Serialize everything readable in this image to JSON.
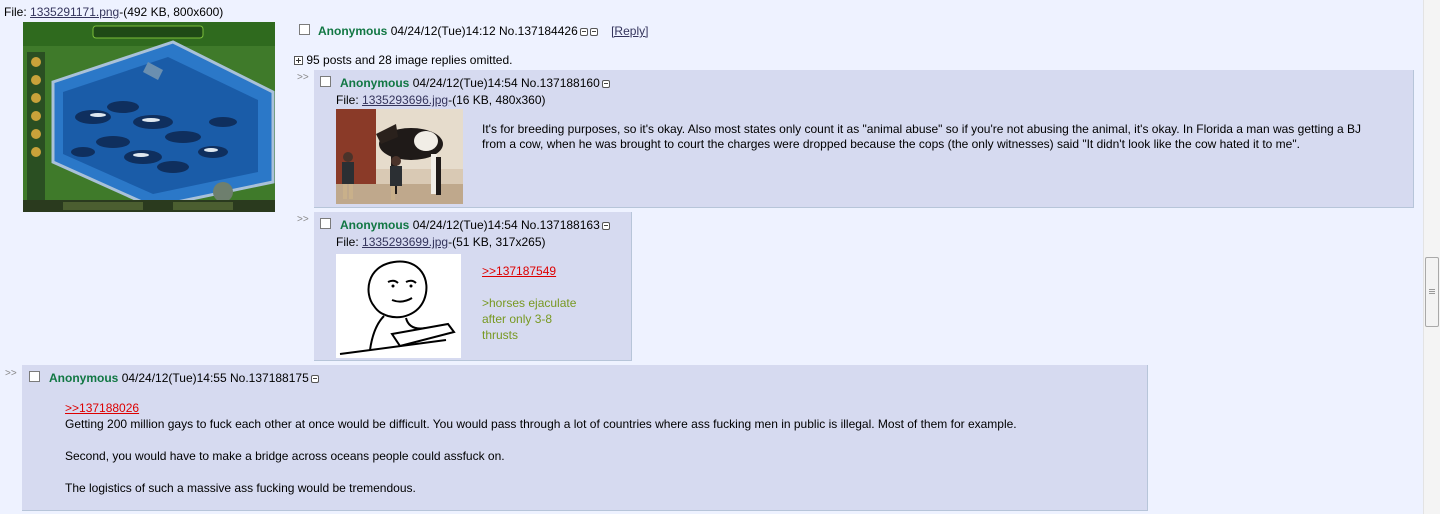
{
  "op": {
    "file_prefix": "File: ",
    "file_name": "1335291171.png",
    "file_info": "-(492 KB, 800x600)",
    "name": "Anonymous",
    "datetime": "04/24/12(Tue)14:12",
    "post_no": "No.137184426",
    "reply_link": "[Reply]",
    "omitted": "95 posts and 28 image replies omitted."
  },
  "replies": [
    {
      "arrows": ">>",
      "name": "Anonymous",
      "datetime": "04/24/12(Tue)14:54",
      "post_no": "No.137188160",
      "file_prefix": "File: ",
      "file_name": "1335293696.jpg",
      "file_info": "-(16 KB, 480x360)",
      "body": "It's for breeding purposes, so it's okay. Also most states only count it as \"animal abuse\" so if you're not abusing the animal, it's okay. In Florida a man was getting a BJ from a cow, when he was brought to court the charges were dropped because the cops (the only witnesses) said \"It didn't look like the cow hated it to me\"."
    },
    {
      "arrows": ">>",
      "name": "Anonymous",
      "datetime": "04/24/12(Tue)14:54",
      "post_no": "No.137188163",
      "file_prefix": "File: ",
      "file_name": "1335293699.jpg",
      "file_info": "-(51 KB, 317x265)",
      "quotelink": ">>137187549",
      "greentext": [
        ">horses ejaculate",
        "after only 3-8",
        "thrusts"
      ]
    },
    {
      "arrows": ">>",
      "name": "Anonymous",
      "datetime": "04/24/12(Tue)14:55",
      "post_no": "No.137188175",
      "quotelink": ">>137188026",
      "lines": [
        "Getting 200 million gays to fuck each other at once would be difficult. You would pass through a lot of countries where ass fucking men in public is illegal. Most of them for example.",
        "Second, you would have to make a bridge across oceans people could assfuck on.",
        "The logistics of such a massive ass fucking would be tremendous."
      ]
    }
  ],
  "colors": {
    "page_bg": "#eef2ff",
    "reply_bg": "#d6daf0",
    "name": "#117743",
    "quotelink": "#dd0000",
    "greentext": "#789922"
  }
}
